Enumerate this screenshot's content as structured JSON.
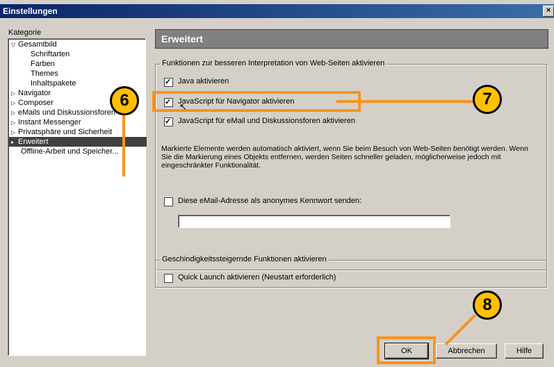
{
  "window": {
    "title": "Einstellungen",
    "close_label": "×"
  },
  "sidebar": {
    "category_label": "Kategorie",
    "items": [
      {
        "label": "Gesamtbild",
        "arrow": "▽"
      },
      {
        "label": "Schriftarten",
        "arrow": ""
      },
      {
        "label": "Farben",
        "arrow": ""
      },
      {
        "label": "Themes",
        "arrow": ""
      },
      {
        "label": "Inhaltspakete",
        "arrow": ""
      },
      {
        "label": "Navigator",
        "arrow": "▷"
      },
      {
        "label": "Composer",
        "arrow": "▷"
      },
      {
        "label": "eMails und Diskussionsforen",
        "arrow": "▷"
      },
      {
        "label": "Instant Messenger",
        "arrow": "▷"
      },
      {
        "label": "Privatsphäre und Sicherheit",
        "arrow": "▷"
      },
      {
        "label": "Erweitert",
        "arrow": "▸"
      },
      {
        "label": "Offline-Arbeit und Speicher...",
        "arrow": ""
      }
    ]
  },
  "main": {
    "header_title": "Erweitert",
    "group1": {
      "legend": "Funktionen zur besseren Interpretation von Web-Seiten aktivieren",
      "java": {
        "label": "Java aktivieren",
        "checked": true
      },
      "js_navigator": {
        "label": "JavaScript für Navigator aktivieren",
        "checked": true
      },
      "js_mail": {
        "label": "JavaScript für eMail und Diskussionsforen aktivieren",
        "checked": true
      },
      "info": "Markierte Elemente werden automatisch aktiviert, wenn Sie beim Besuch von Web-Seiten benötigt werden. Wenn Sie die Markierung eines Objekts entfernen, werden Seiten schneller geladen, möglicherweise jedoch mit eingeschränkter Funktionalität.",
      "anon_email": {
        "label": "Diese eMail-Adresse als anonymes Kennwort senden:",
        "checked": false
      },
      "email_value": ""
    },
    "group2": {
      "legend": "Geschindigkeitssteigernde Funktionen aktivieren",
      "quick_launch": {
        "label": "Quick Launch aktivieren (Neustart erforderlich)",
        "checked": false
      }
    }
  },
  "buttons": {
    "ok": "OK",
    "cancel": "Abbrechen",
    "help": "Hilfe"
  },
  "callouts": {
    "six": "6",
    "seven": "7",
    "eight": "8"
  },
  "colors": {
    "accent_orange": "#f7941d",
    "callout_fill": "#ffc000",
    "title_bar": "#0a246a",
    "dialog_bg": "#d4d0c8"
  }
}
